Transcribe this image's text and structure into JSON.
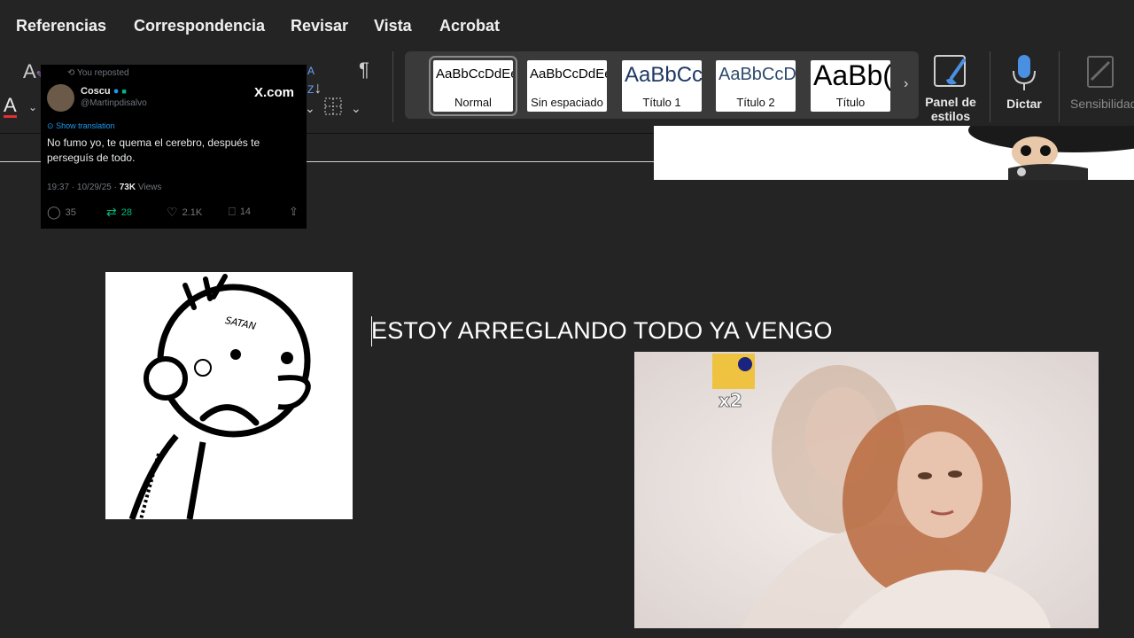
{
  "menu": {
    "items": [
      "Referencias",
      "Correspondencia",
      "Revisar",
      "Vista",
      "Acrobat"
    ]
  },
  "styles_gallery": {
    "tiles": [
      {
        "sample": "AaBbCcDdEe",
        "name": "Normal",
        "selected": true
      },
      {
        "sample": "AaBbCcDdEe",
        "name": "Sin espaciado"
      },
      {
        "sample": "AaBbCc",
        "name": "Título 1"
      },
      {
        "sample": "AaBbCcDd",
        "name": "Título 2"
      },
      {
        "sample": "AaBb(",
        "name": "Título"
      }
    ],
    "more_icon": "chevron-right-icon"
  },
  "ribbon": {
    "styles_pane_label": "Panel de estilos",
    "dictate_label": "Dictar",
    "sensitivity_label": "Sensibilidad",
    "paragraph_mark": "¶",
    "font_color_letter": "A",
    "font_color_accent": "#e03030"
  },
  "tweet": {
    "repost_label": "You reposted",
    "display_name": "Coscu",
    "handle": "@Martinpdisalvo",
    "site": "X.com",
    "translate_label": "Show translation",
    "text": "No fumo yo, te quema el cerebro, después te perseguís de todo.",
    "timestamp": "19:37 · 10/29/25 · ",
    "views_count": "73K",
    "views_label": " Views",
    "replies": "35",
    "reposts": "28",
    "likes": "2.1K",
    "bookmarks": "14",
    "repost_color": "#00ba7c"
  },
  "document": {
    "body_text": "ESTOY ARREGLANDO TODO YA VENGO",
    "drawing_caption": "SATAN",
    "photo_badge": "x2"
  }
}
